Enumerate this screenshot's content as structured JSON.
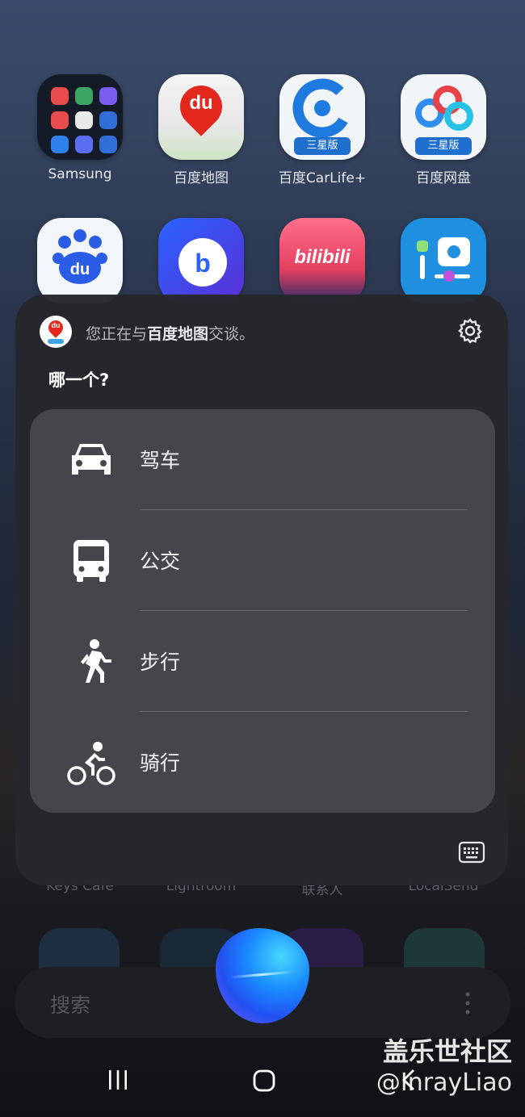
{
  "home_apps": [
    {
      "label": "Samsung"
    },
    {
      "label": "百度地图"
    },
    {
      "label": "百度CarLife+",
      "badge": "三星版"
    },
    {
      "label": "百度网盘",
      "badge": "三星版"
    }
  ],
  "home_apps_row2": [
    {
      "name": "baidu-app",
      "icon_text": "du"
    },
    {
      "name": "bixby-app",
      "icon_text": "b"
    },
    {
      "name": "bilibili-app",
      "icon_text": "bilibili"
    },
    {
      "name": "good-lock-app"
    }
  ],
  "assistant": {
    "app_icon_text": "du",
    "talking_prefix": "您正在与",
    "talking_app": "百度地图",
    "talking_suffix": "交谈。",
    "question": "哪一个?",
    "options": [
      {
        "label": "驾车",
        "icon": "car-icon"
      },
      {
        "label": "公交",
        "icon": "bus-icon"
      },
      {
        "label": "步行",
        "icon": "walking-icon"
      },
      {
        "label": "骑行",
        "icon": "cycling-icon"
      }
    ]
  },
  "dimmed_labels": [
    "Keys Cafe",
    "Lightroom",
    "联系人",
    "LocalSend"
  ],
  "search": {
    "placeholder": "搜索"
  },
  "watermark": {
    "line1": "盖乐世社区",
    "line2": "@InrayLiao"
  },
  "colors": {
    "accent": "#1a8cff",
    "sheet": "#26272c",
    "card": "#45464b"
  }
}
